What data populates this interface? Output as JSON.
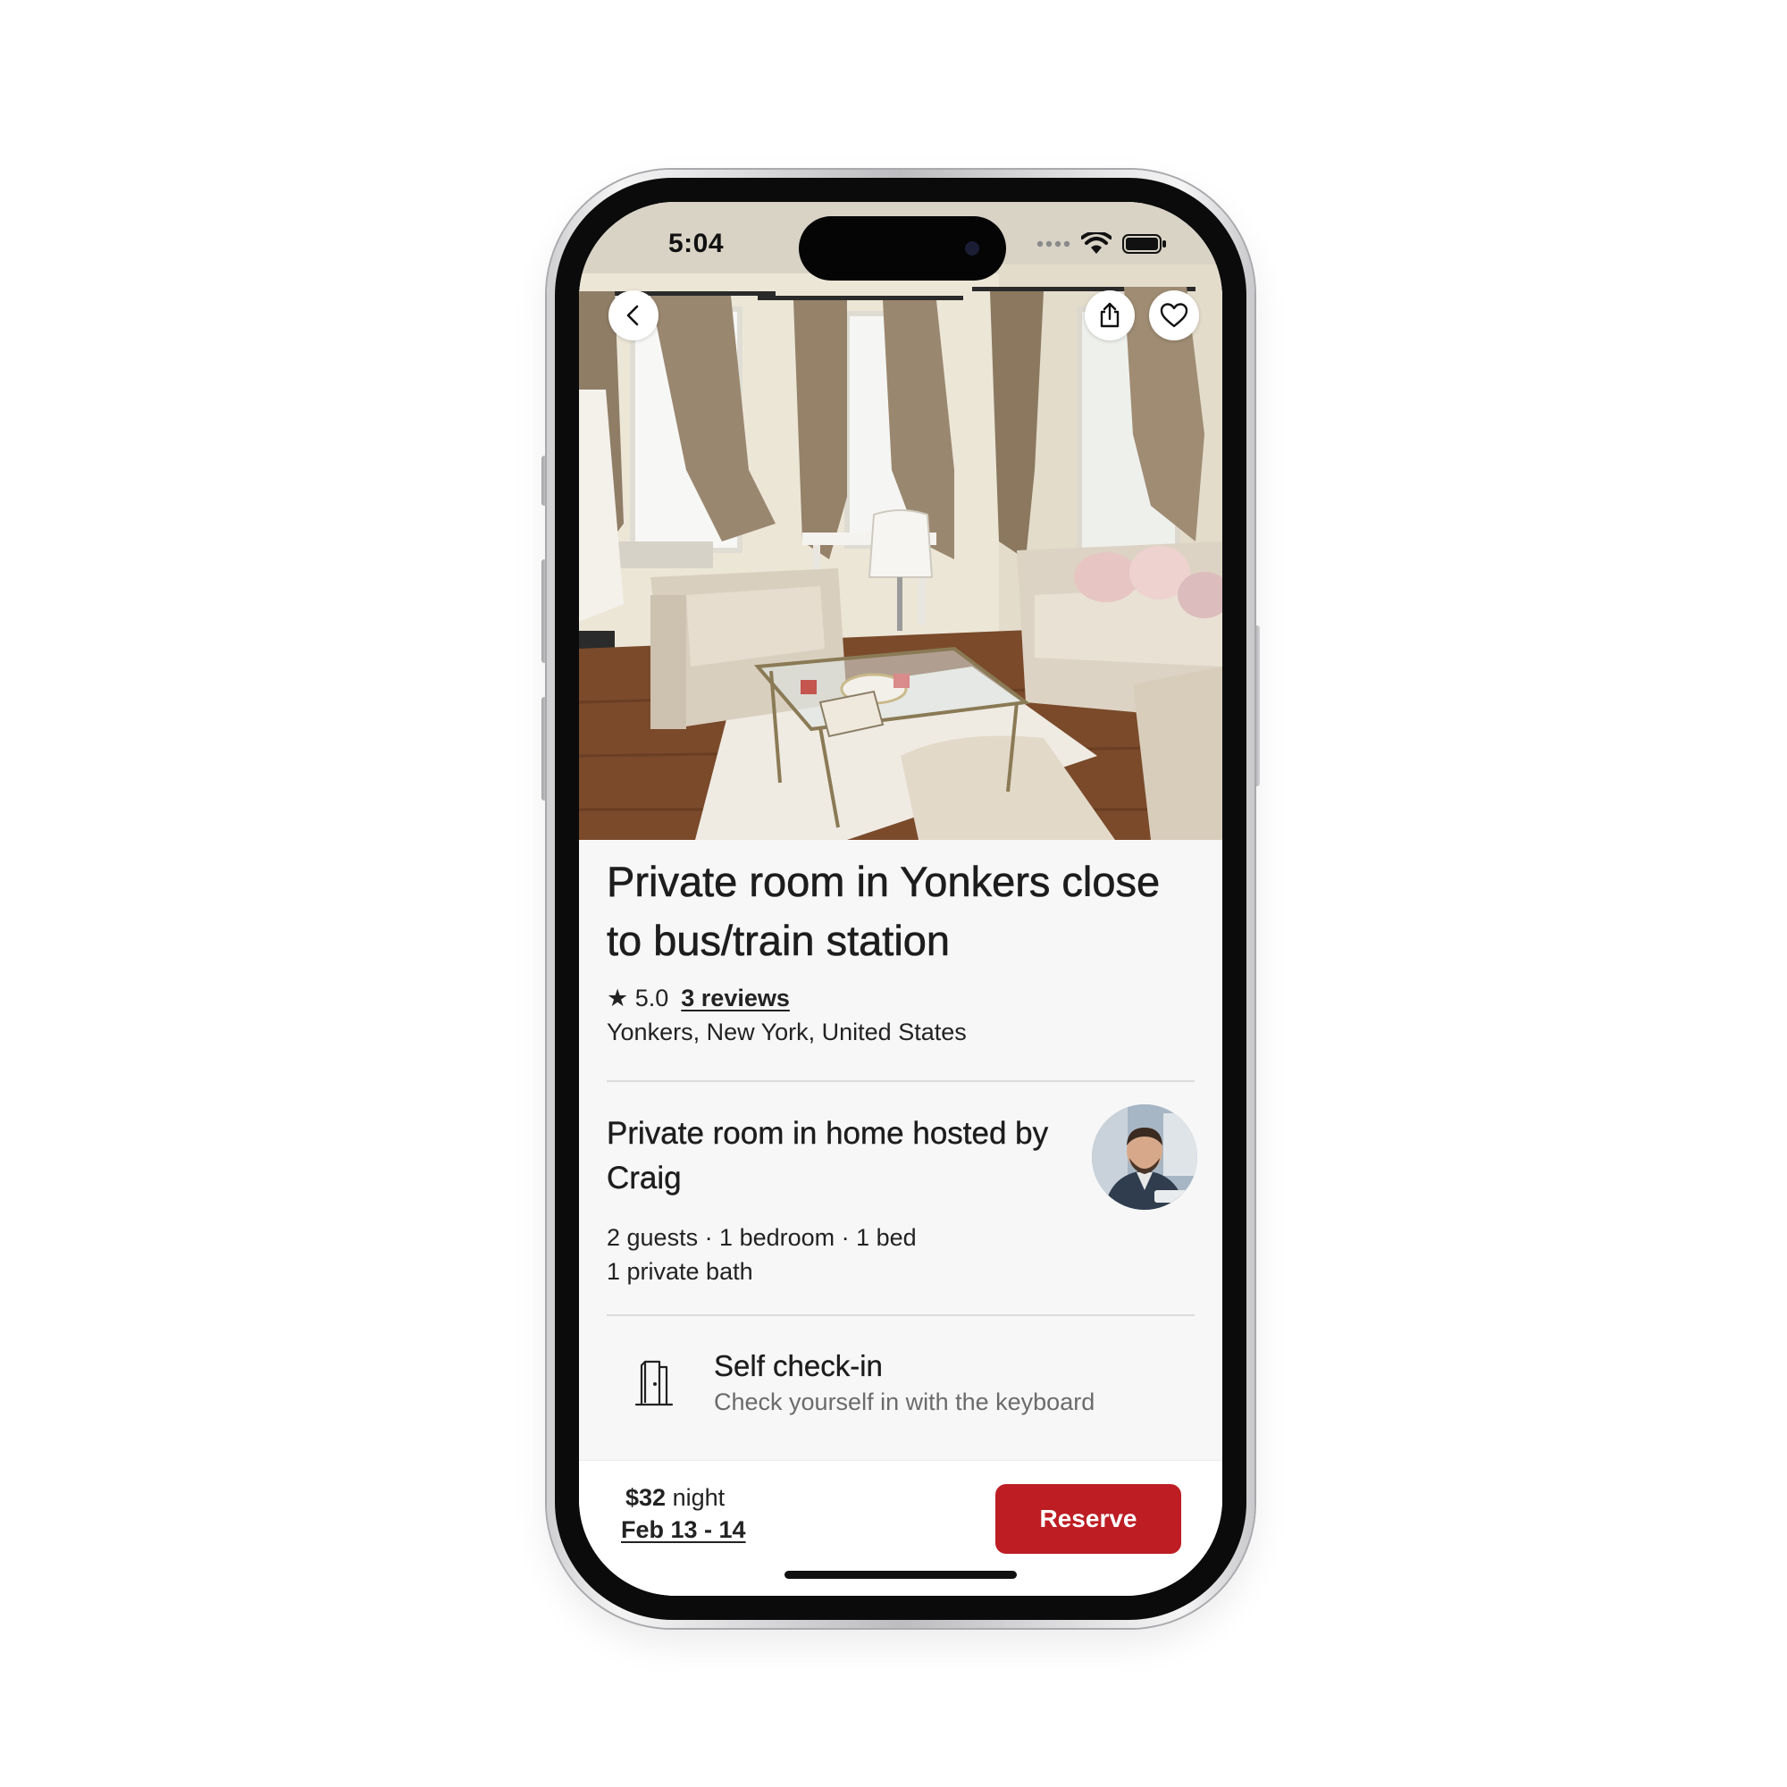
{
  "status_bar": {
    "time": "5:04"
  },
  "photo": {
    "subject": "living-room-photo"
  },
  "nav": {
    "back_icon": "chevron-left-icon",
    "share_icon": "share-icon",
    "save_icon": "heart-icon"
  },
  "listing": {
    "title": "Private room in Yonkers close to bus/train station",
    "rating_star": "★",
    "rating": "5.0",
    "reviews": "3 reviews",
    "location": "Yonkers, New York, United States"
  },
  "host_section": {
    "title": "Private room in home hosted by Craig",
    "details_line1": "2 guests · 1 bedroom · 1 bed",
    "details_line2": "1 private bath"
  },
  "highlight": {
    "icon": "door-icon",
    "title": "Self check-in",
    "description": "Check yourself in with the keyboard"
  },
  "booking": {
    "price": "$32",
    "unit": "night",
    "dates": "Feb 13 - 14",
    "reserve_label": "Reserve"
  },
  "colors": {
    "accent": "#bd1d23",
    "text_primary": "#1d1d1d",
    "text_secondary": "#6b6b6b",
    "background": "#f7f7f7"
  }
}
